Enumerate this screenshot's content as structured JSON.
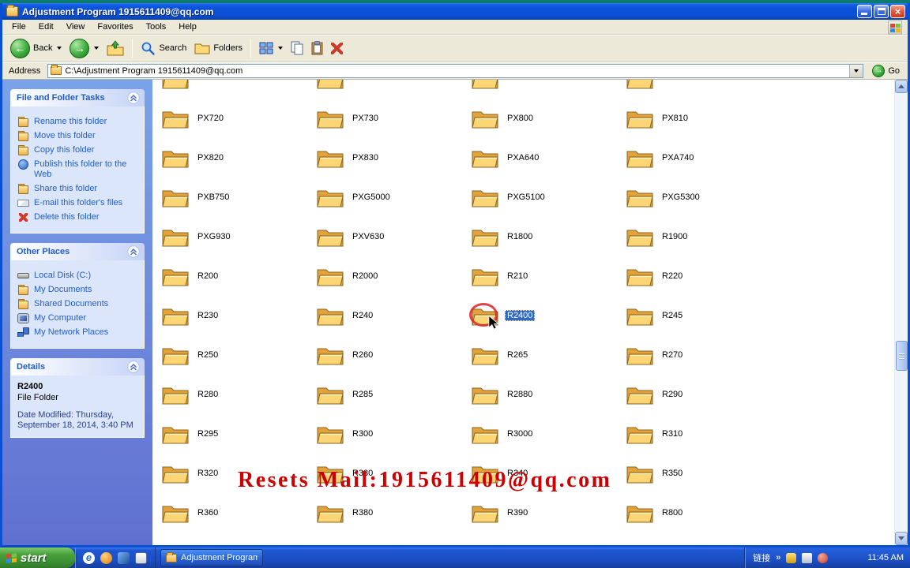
{
  "window": {
    "title": "Adjustment Program 1915611409@qq.com"
  },
  "menu": {
    "items": [
      "File",
      "Edit",
      "View",
      "Favorites",
      "Tools",
      "Help"
    ]
  },
  "toolbar": {
    "back_label": "Back",
    "search_label": "Search",
    "folders_label": "Folders"
  },
  "address_bar": {
    "label": "Address",
    "value": "C:\\Adjustment Program 1915611409@qq.com",
    "go_label": "Go"
  },
  "sidebar": {
    "tasks": {
      "title": "File and Folder Tasks",
      "items": [
        {
          "icon": "rename-folder-icon",
          "label": "Rename this folder"
        },
        {
          "icon": "move-folder-icon",
          "label": "Move this folder"
        },
        {
          "icon": "copy-folder-icon",
          "label": "Copy this folder"
        },
        {
          "icon": "publish-web-icon",
          "label": "Publish this folder to the Web"
        },
        {
          "icon": "share-folder-icon",
          "label": "Share this folder"
        },
        {
          "icon": "email-icon",
          "label": "E-mail this folder's files"
        },
        {
          "icon": "delete-icon",
          "label": "Delete this folder"
        }
      ]
    },
    "other_places": {
      "title": "Other Places",
      "items": [
        {
          "icon": "drive-icon",
          "label": "Local Disk (C:)"
        },
        {
          "icon": "folder-icon",
          "label": "My Documents"
        },
        {
          "icon": "folder-icon",
          "label": "Shared Documents"
        },
        {
          "icon": "computer-icon",
          "label": "My Computer"
        },
        {
          "icon": "network-icon",
          "label": "My Network Places"
        }
      ]
    },
    "details": {
      "title": "Details",
      "name": "R2400",
      "type": "File Folder",
      "modified": "Date Modified: Thursday, September 18, 2014, 3:40 PM"
    }
  },
  "folders": [
    {
      "name": "",
      "variant": "partial"
    },
    {
      "name": "",
      "variant": "partial"
    },
    {
      "name": "",
      "variant": "partial"
    },
    {
      "name": "",
      "variant": "partial"
    },
    {
      "name": "PX720"
    },
    {
      "name": "PX730"
    },
    {
      "name": "PX800"
    },
    {
      "name": "PX810"
    },
    {
      "name": "PX820"
    },
    {
      "name": "PX830"
    },
    {
      "name": "PXA640"
    },
    {
      "name": "PXA740"
    },
    {
      "name": "PXB750"
    },
    {
      "name": "PXG5000"
    },
    {
      "name": "PXG5100"
    },
    {
      "name": "PXG5300"
    },
    {
      "name": "PXG930"
    },
    {
      "name": "PXV630"
    },
    {
      "name": "R1800"
    },
    {
      "name": "R1900"
    },
    {
      "name": "R200"
    },
    {
      "name": "R2000"
    },
    {
      "name": "R210"
    },
    {
      "name": "R220"
    },
    {
      "name": "R230"
    },
    {
      "name": "R240"
    },
    {
      "name": "R2400",
      "variant": "selected"
    },
    {
      "name": "R245"
    },
    {
      "name": "R250"
    },
    {
      "name": "R260"
    },
    {
      "name": "R265"
    },
    {
      "name": "R270"
    },
    {
      "name": "R280"
    },
    {
      "name": "R285"
    },
    {
      "name": "R2880"
    },
    {
      "name": "R290"
    },
    {
      "name": "R295"
    },
    {
      "name": "R300"
    },
    {
      "name": "R3000"
    },
    {
      "name": "R310"
    },
    {
      "name": "R320"
    },
    {
      "name": "R330"
    },
    {
      "name": "R340"
    },
    {
      "name": "R350"
    },
    {
      "name": "R360"
    },
    {
      "name": "R380"
    },
    {
      "name": "R390"
    },
    {
      "name": "R800"
    },
    {
      "name": "",
      "variant": "partial"
    },
    {
      "name": "",
      "variant": "partial"
    },
    {
      "name": "",
      "variant": "partial"
    },
    {
      "name": "",
      "variant": "partial"
    }
  ],
  "overlay": {
    "text": "Resets Mail:1915611409@qq.com"
  },
  "taskbar": {
    "start_label": "start",
    "task_button": "Adjustment Program ...",
    "tray": {
      "links_label": "链接",
      "chevron": "»",
      "time": "11:45 AM"
    }
  },
  "icons": {
    "back": "green-circle-left-arrow",
    "forward": "green-circle-right-arrow",
    "up": "folder-with-up-arrow",
    "search": "magnifier",
    "folders": "folder-pane",
    "views": "grid-squares",
    "delete": "red-x",
    "go": "green-circle-right-arrow"
  }
}
